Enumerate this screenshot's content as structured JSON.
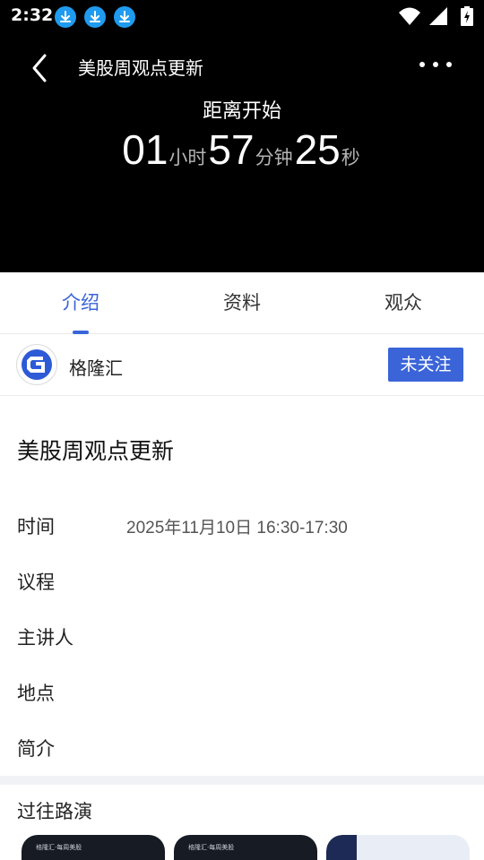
{
  "status_bar": {
    "time": "2:32",
    "icons": [
      "download-icon",
      "download-icon",
      "download-icon",
      "wifi-icon",
      "signal-icon",
      "battery-charging-icon"
    ]
  },
  "header": {
    "title": "美股周观点更新",
    "back_icon": "chevron-left-icon",
    "more_icon": "more-horizontal-icon"
  },
  "countdown": {
    "label": "距离开始",
    "hours": "01",
    "hours_unit": "小时",
    "minutes": "57",
    "minutes_unit": "分钟",
    "seconds": "25",
    "seconds_unit": "秒"
  },
  "tabs": [
    {
      "label": "介绍",
      "active": true
    },
    {
      "label": "资料",
      "active": false
    },
    {
      "label": "观众",
      "active": false
    }
  ],
  "host": {
    "name": "格隆汇",
    "follow_label": "未关注"
  },
  "details": {
    "title": "美股周观点更新",
    "rows": [
      {
        "label": "时间",
        "value": "2025年11月10日 16:30-17:30"
      },
      {
        "label": "议程",
        "value": ""
      },
      {
        "label": "主讲人",
        "value": ""
      },
      {
        "label": "地点",
        "value": ""
      },
      {
        "label": "简介",
        "value": ""
      }
    ]
  },
  "past": {
    "title": "过往路演",
    "thumbs": [
      {
        "caption": "格隆汇·每周美股"
      },
      {
        "caption": "格隆汇·每周美股"
      },
      {
        "caption": ""
      }
    ]
  },
  "colors": {
    "accent": "#3a64d8",
    "header_bg": "#000000",
    "download_badge": "#1f9bef"
  }
}
